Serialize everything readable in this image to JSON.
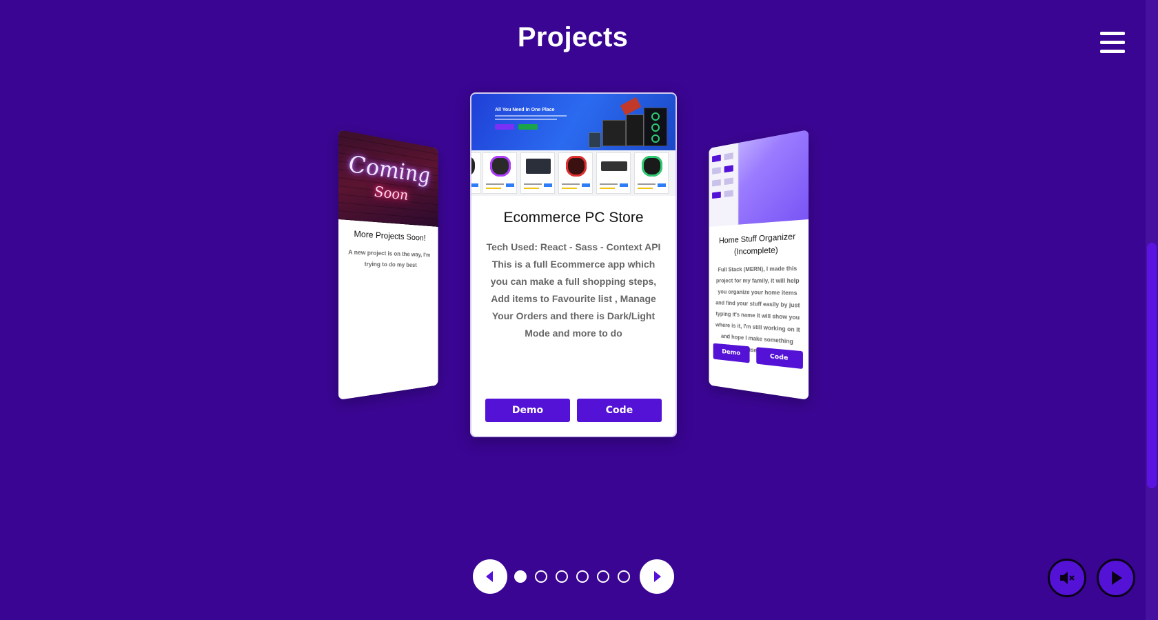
{
  "section": {
    "title": "Projects"
  },
  "menu": {
    "icon": "hamburger-icon"
  },
  "cards": {
    "left": {
      "image_text_top": "Coming",
      "image_text_bottom": "Soon",
      "title": "More Projects Soon!",
      "description": "A new project is on the way, I'm trying to do my best"
    },
    "main": {
      "image_headline": "All You Need In One Place",
      "title": "Ecommerce PC Store",
      "description": "Tech Used: React - Sass - Context API This is a full Ecommerce app which you can make a full shopping steps, Add items to Favourite list , Manage Your Orders and there is Dark/Light Mode and more to do",
      "demo_label": "Demo",
      "code_label": "Code"
    },
    "right": {
      "title": "Home Stuff Organizer (Incomplete)",
      "description": "Full Stack (MERN), I made this project for my family, it will help you organize your home items and find your stuff easily by just typing it's name it will show you where is it, I'm still working on it and hope I make something useful",
      "demo_label": "Demo",
      "code_label": "Code"
    }
  },
  "pagination": {
    "total": 6,
    "active_index": 0
  },
  "media": {
    "mute_icon": "speaker-muted-icon",
    "play_icon": "play-icon"
  },
  "colors": {
    "background": "#3a0593",
    "accent": "#5412d6",
    "card": "#ffffff"
  }
}
